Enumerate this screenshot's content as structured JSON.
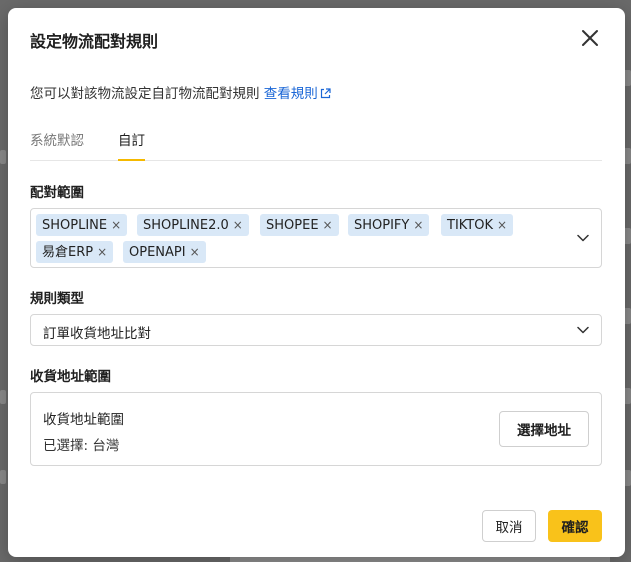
{
  "modal": {
    "title": "設定物流配對規則",
    "description": "您可以對該物流設定自訂物流配對規則",
    "rules_link": "查看規則"
  },
  "tabs": [
    {
      "label": "系統默認",
      "active": false
    },
    {
      "label": "自訂",
      "active": true
    }
  ],
  "match_scope": {
    "label": "配對範圍",
    "tags": [
      "SHOPLINE",
      "SHOPLINE2.0",
      "SHOPEE",
      "SHOPIFY",
      "TIKTOK",
      "易倉ERP",
      "OPENAPI"
    ],
    "remove_glyph": "×"
  },
  "rule_type": {
    "label": "規則類型",
    "value": "訂單收貨地址比對"
  },
  "address_scope": {
    "label": "收貨地址範圍",
    "box_title": "收貨地址範圍",
    "selected_text": "已選擇: 台灣",
    "choose_button": "選擇地址"
  },
  "footer": {
    "cancel": "取消",
    "confirm": "確認"
  },
  "colors": {
    "accent": "#f9c21a",
    "link": "#1a66d6",
    "tag_bg": "#d9e8f7"
  }
}
